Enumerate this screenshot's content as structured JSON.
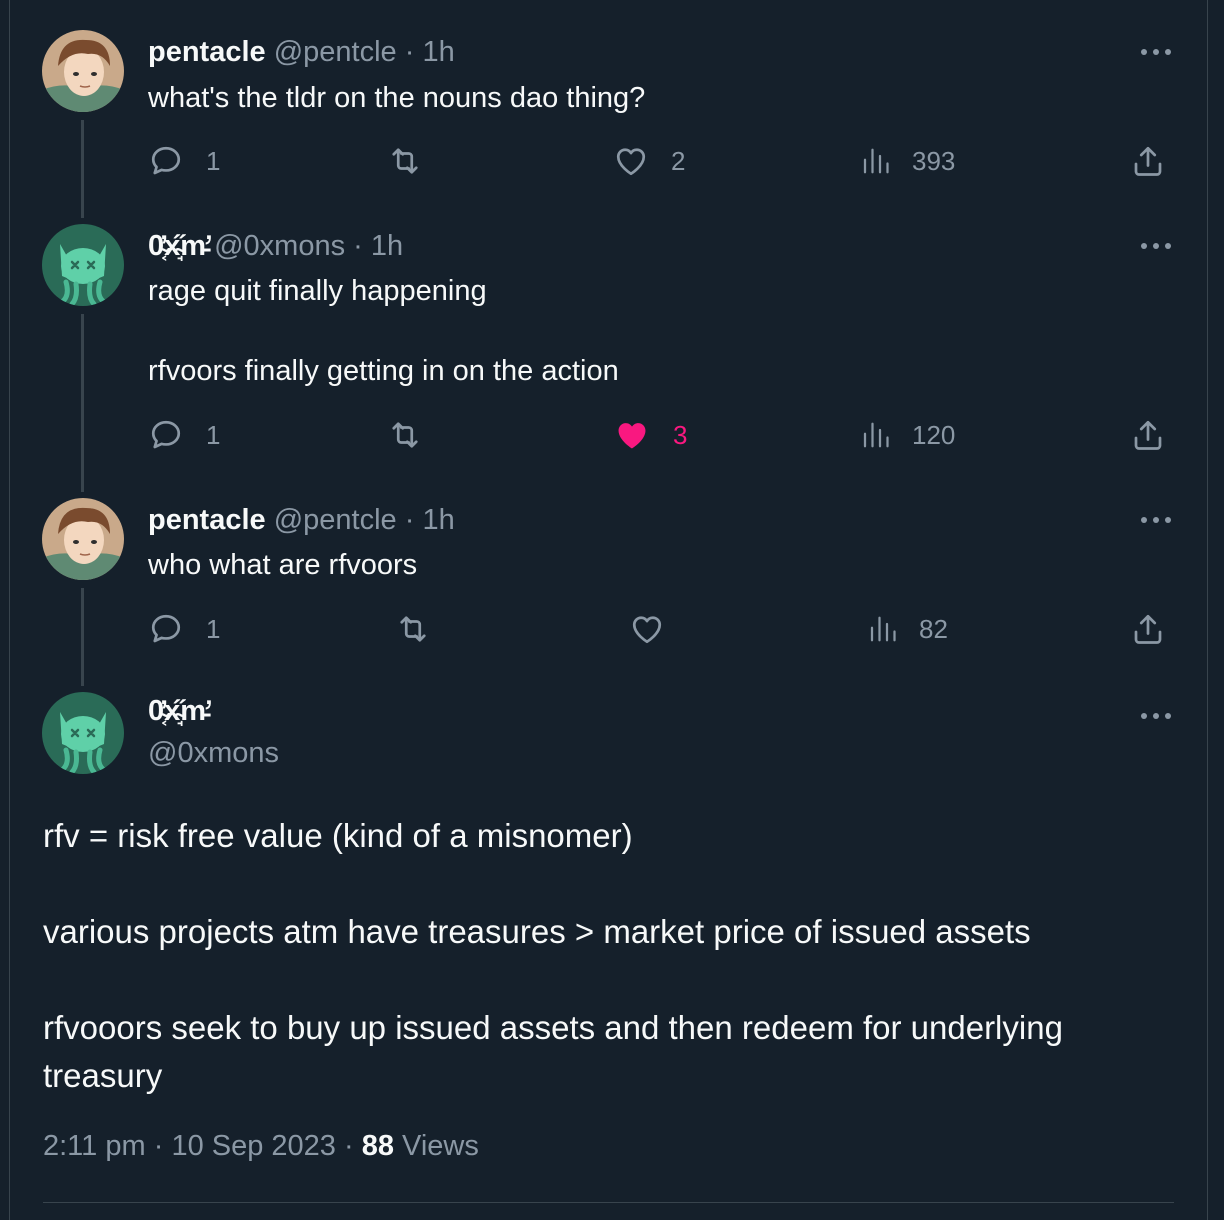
{
  "thread": [
    {
      "name": "pentacle",
      "handle": "@pentcle",
      "time": "1h",
      "text": "what's the tldr on the nouns dao thing?",
      "replies": "1",
      "retweets": "",
      "likes": "2",
      "views": "393",
      "liked": false
    },
    {
      "name": "0̴͔̓x̴̘̋m̵̛",
      "handle": "@0xmons",
      "time": "1h",
      "text": "rage quit finally happening\n\nrfvoors finally getting in on the action",
      "replies": "1",
      "retweets": "",
      "likes": "3",
      "views": "120",
      "liked": true
    },
    {
      "name": "pentacle",
      "handle": "@pentcle",
      "time": "1h",
      "text": "who what are rfvoors",
      "replies": "1",
      "retweets": "",
      "likes": "",
      "views": "82",
      "liked": false
    }
  ],
  "main": {
    "name": "0̴͔̓x̴̘̋m̵̛",
    "handle": "@0xmons",
    "text": "rfv = risk free value (kind of a misnomer)\n\nvarious projects atm have treasures > market price of issued assets\n\nrfvooors seek to buy up issued assets and then redeem for underlying treasury",
    "time": "2:11 pm",
    "date": "10 Sep 2023",
    "views_count": "88",
    "views_label": "Views"
  },
  "separator": "·",
  "colors": {
    "background": "#15202b",
    "text": "#f7f9f9",
    "muted": "#8b98a5",
    "like_active": "#f91880",
    "border": "#38444d"
  },
  "icons": [
    "reply-icon",
    "retweet-icon",
    "like-icon",
    "views-icon",
    "share-icon",
    "more-icon"
  ]
}
